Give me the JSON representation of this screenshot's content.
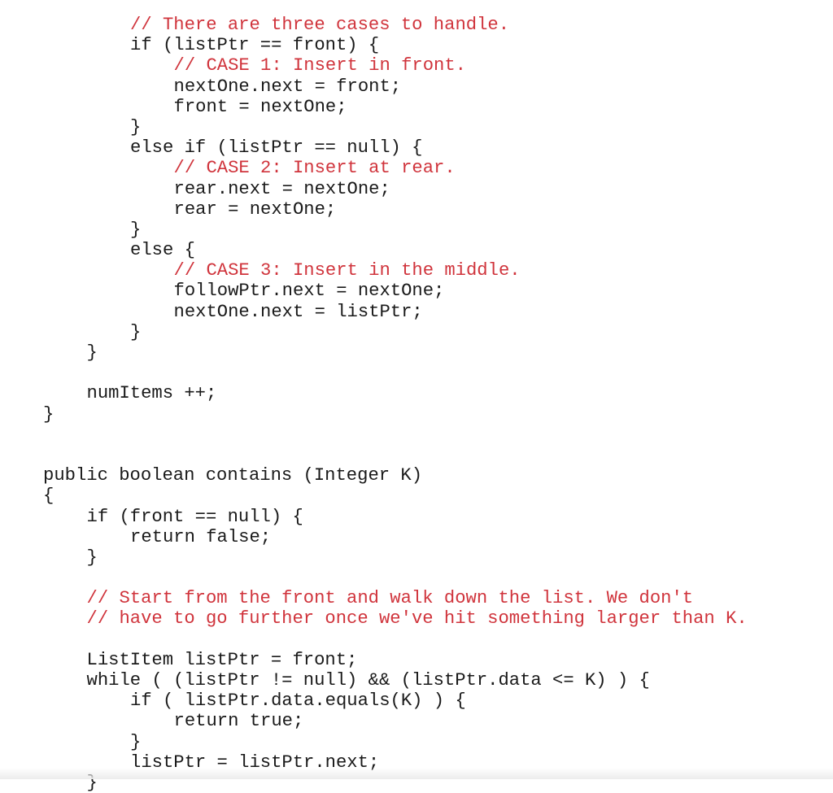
{
  "document": {
    "type": "source-code",
    "language": "java",
    "colors": {
      "code": "#1a1a1a",
      "comment": "#d0343c",
      "background": "#ffffff"
    },
    "lines": [
      {
        "indent": 2,
        "kind": "comment",
        "text": "// There are three cases to handle."
      },
      {
        "indent": 2,
        "kind": "code",
        "text": "if (listPtr == front) {"
      },
      {
        "indent": 3,
        "kind": "comment",
        "text": "// CASE 1: Insert in front."
      },
      {
        "indent": 3,
        "kind": "code",
        "text": "nextOne.next = front;"
      },
      {
        "indent": 3,
        "kind": "code",
        "text": "front = nextOne;"
      },
      {
        "indent": 2,
        "kind": "code",
        "text": "}"
      },
      {
        "indent": 2,
        "kind": "code",
        "text": "else if (listPtr == null) {"
      },
      {
        "indent": 3,
        "kind": "comment",
        "text": "// CASE 2: Insert at rear."
      },
      {
        "indent": 3,
        "kind": "code",
        "text": "rear.next = nextOne;"
      },
      {
        "indent": 3,
        "kind": "code",
        "text": "rear = nextOne;"
      },
      {
        "indent": 2,
        "kind": "code",
        "text": "}"
      },
      {
        "indent": 2,
        "kind": "code",
        "text": "else {"
      },
      {
        "indent": 3,
        "kind": "comment",
        "text": "// CASE 3: Insert in the middle."
      },
      {
        "indent": 3,
        "kind": "code",
        "text": "followPtr.next = nextOne;"
      },
      {
        "indent": 3,
        "kind": "code",
        "text": "nextOne.next = listPtr;"
      },
      {
        "indent": 2,
        "kind": "code",
        "text": "}"
      },
      {
        "indent": 1,
        "kind": "code",
        "text": "}"
      },
      {
        "indent": 0,
        "kind": "blank",
        "text": ""
      },
      {
        "indent": 1,
        "kind": "code",
        "text": "numItems ++;"
      },
      {
        "indent": 0,
        "kind": "code",
        "text": "}"
      },
      {
        "indent": 0,
        "kind": "blank",
        "text": ""
      },
      {
        "indent": 0,
        "kind": "blank",
        "text": ""
      },
      {
        "indent": 0,
        "kind": "code",
        "text": "public boolean contains (Integer K)"
      },
      {
        "indent": 0,
        "kind": "code",
        "text": "{"
      },
      {
        "indent": 1,
        "kind": "code",
        "text": "if (front == null) {"
      },
      {
        "indent": 2,
        "kind": "code",
        "text": "return false;"
      },
      {
        "indent": 1,
        "kind": "code",
        "text": "}"
      },
      {
        "indent": 0,
        "kind": "blank",
        "text": ""
      },
      {
        "indent": 1,
        "kind": "comment",
        "text": "// Start from the front and walk down the list. We don't"
      },
      {
        "indent": 1,
        "kind": "comment",
        "text": "// have to go further once we've hit something larger than K."
      },
      {
        "indent": 0,
        "kind": "blank",
        "text": ""
      },
      {
        "indent": 1,
        "kind": "code",
        "text": "ListItem listPtr = front;"
      },
      {
        "indent": 1,
        "kind": "code",
        "text": "while ( (listPtr != null) && (listPtr.data <= K) ) {"
      },
      {
        "indent": 2,
        "kind": "code",
        "text": "if ( listPtr.data.equals(K) ) {"
      },
      {
        "indent": 3,
        "kind": "code",
        "text": "return true;"
      },
      {
        "indent": 2,
        "kind": "code",
        "text": "}"
      },
      {
        "indent": 2,
        "kind": "code",
        "text": "listPtr = listPtr.next;"
      },
      {
        "indent": 1,
        "kind": "code",
        "text": "}"
      }
    ]
  }
}
